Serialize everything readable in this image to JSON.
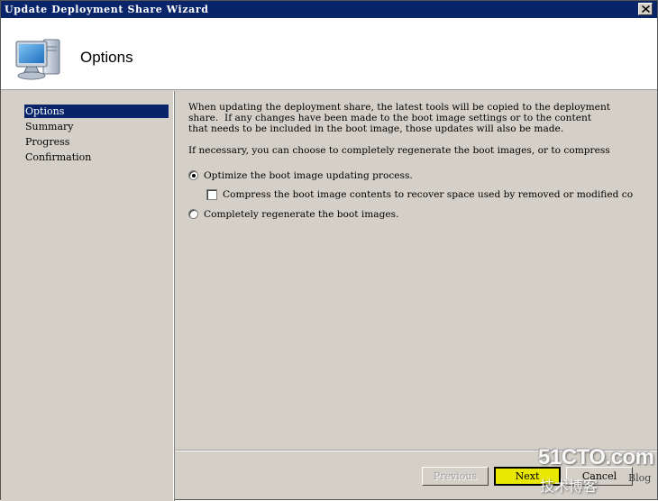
{
  "window": {
    "title": "Update Deployment Share Wizard",
    "close_icon": "close-icon"
  },
  "header": {
    "heading": "Options",
    "icon": "computer-monitor-icon"
  },
  "nav": {
    "items": [
      {
        "label": "Options",
        "active": true
      },
      {
        "label": "Summary",
        "active": false
      },
      {
        "label": "Progress",
        "active": false
      },
      {
        "label": "Confirmation",
        "active": false
      }
    ]
  },
  "content": {
    "paragraph1": [
      "When updating the deployment share, the latest tools will be copied to the deployment",
      "share.  If any changes have been made to the boot image settings or to the content",
      "that needs to be included in the boot image, those updates will also be made."
    ],
    "paragraph2": "If necessary, you can choose to completely regenerate the boot images, or to compress",
    "options": {
      "optimize": {
        "label": "Optimize the boot image updating process.",
        "selected": true
      },
      "compress": {
        "label": "Compress the boot image contents to recover space used by removed or modified co",
        "checked": false
      },
      "regenerate": {
        "label": "Completely regenerate the boot images.",
        "selected": false
      }
    }
  },
  "footer": {
    "previous_label": "Previous",
    "next_label": "Next",
    "cancel_label": "Cancel"
  },
  "watermark": {
    "top": "51CTO.com",
    "bottom": "技术博客",
    "blog": "Blog"
  },
  "colors": {
    "titlebar": "#0a246a",
    "selection": "#0a246a",
    "dialog_face": "#d4d0c8",
    "default_button": "#e8e800"
  }
}
